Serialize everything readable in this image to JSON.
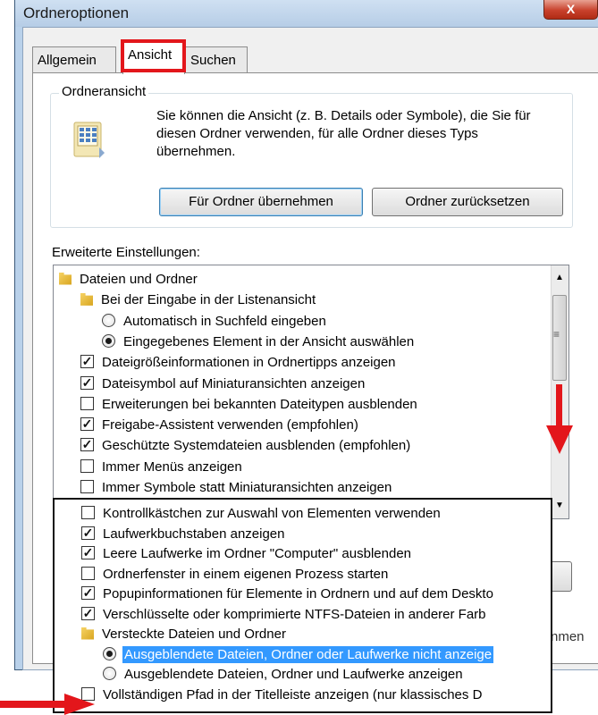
{
  "window": {
    "title": "Ordneroptionen",
    "close_glyph": "X"
  },
  "tabs": [
    {
      "label": "Allgemein",
      "active": false
    },
    {
      "label": "Ansicht",
      "active": true
    },
    {
      "label": "Suchen",
      "active": false
    }
  ],
  "ordneransicht": {
    "group_label": "Ordneransicht",
    "description": "Sie können die Ansicht (z. B. Details oder Symbole), die Sie für diesen Ordner verwenden, für alle Ordner dieses Typs übernehmen.",
    "apply_button": "Für Ordner übernehmen",
    "reset_button": "Ordner zurücksetzen"
  },
  "advanced": {
    "label": "Erweiterte Einstellungen:",
    "items": [
      {
        "type": "folder",
        "indent": 0,
        "label": "Dateien und Ordner"
      },
      {
        "type": "folder",
        "indent": 1,
        "label": "Bei der Eingabe in der Listenansicht"
      },
      {
        "type": "radio",
        "indent": 2,
        "checked": false,
        "label": "Automatisch in Suchfeld eingeben"
      },
      {
        "type": "radio",
        "indent": 2,
        "checked": true,
        "label": "Eingegebenes Element in der Ansicht auswählen"
      },
      {
        "type": "check",
        "indent": 1,
        "checked": true,
        "label": "Dateigrößeinformationen in Ordnertipps anzeigen"
      },
      {
        "type": "check",
        "indent": 1,
        "checked": true,
        "label": "Dateisymbol auf Miniaturansichten anzeigen"
      },
      {
        "type": "check",
        "indent": 1,
        "checked": false,
        "label": "Erweiterungen bei bekannten Dateitypen ausblenden"
      },
      {
        "type": "check",
        "indent": 1,
        "checked": true,
        "label": "Freigabe-Assistent verwenden (empfohlen)"
      },
      {
        "type": "check",
        "indent": 1,
        "checked": true,
        "label": "Geschützte Systemdateien ausblenden (empfohlen)"
      },
      {
        "type": "check",
        "indent": 1,
        "checked": false,
        "label": "Immer Menüs anzeigen"
      },
      {
        "type": "check",
        "indent": 1,
        "checked": false,
        "label": "Immer Symbole statt Miniaturansichten anzeigen"
      }
    ]
  },
  "zoom_items": [
    {
      "type": "check",
      "indent": 1,
      "checked": false,
      "selected": false,
      "label": "Kontrollkästchen zur Auswahl von Elementen verwenden"
    },
    {
      "type": "check",
      "indent": 1,
      "checked": true,
      "selected": false,
      "label": "Laufwerkbuchstaben anzeigen"
    },
    {
      "type": "check",
      "indent": 1,
      "checked": true,
      "selected": false,
      "label": "Leere Laufwerke im Ordner \"Computer\" ausblenden"
    },
    {
      "type": "check",
      "indent": 1,
      "checked": false,
      "selected": false,
      "label": "Ordnerfenster in einem eigenen Prozess starten"
    },
    {
      "type": "check",
      "indent": 1,
      "checked": true,
      "selected": false,
      "label": "Popupinformationen für Elemente in Ordnern und auf dem Deskto"
    },
    {
      "type": "check",
      "indent": 1,
      "checked": true,
      "selected": false,
      "label": "Verschlüsselte oder komprimierte NTFS-Dateien in anderer Farb"
    },
    {
      "type": "folder",
      "indent": 1,
      "selected": false,
      "label": "Versteckte Dateien und Ordner"
    },
    {
      "type": "radio",
      "indent": 2,
      "checked": true,
      "selected": true,
      "label": "Ausgeblendete Dateien, Ordner oder Laufwerke nicht anzeige"
    },
    {
      "type": "radio",
      "indent": 2,
      "checked": false,
      "selected": false,
      "label": "Ausgeblendete Dateien, Ordner und Laufwerke anzeigen"
    },
    {
      "type": "check",
      "indent": 1,
      "checked": false,
      "selected": false,
      "label": "Vollständigen Pfad in der Titelleiste anzeigen (nur klassisches D"
    }
  ],
  "background_fragment": "nmen",
  "colors": {
    "highlight": "#e3161b",
    "selection": "#3399ff",
    "arrow": "#e3161b"
  }
}
